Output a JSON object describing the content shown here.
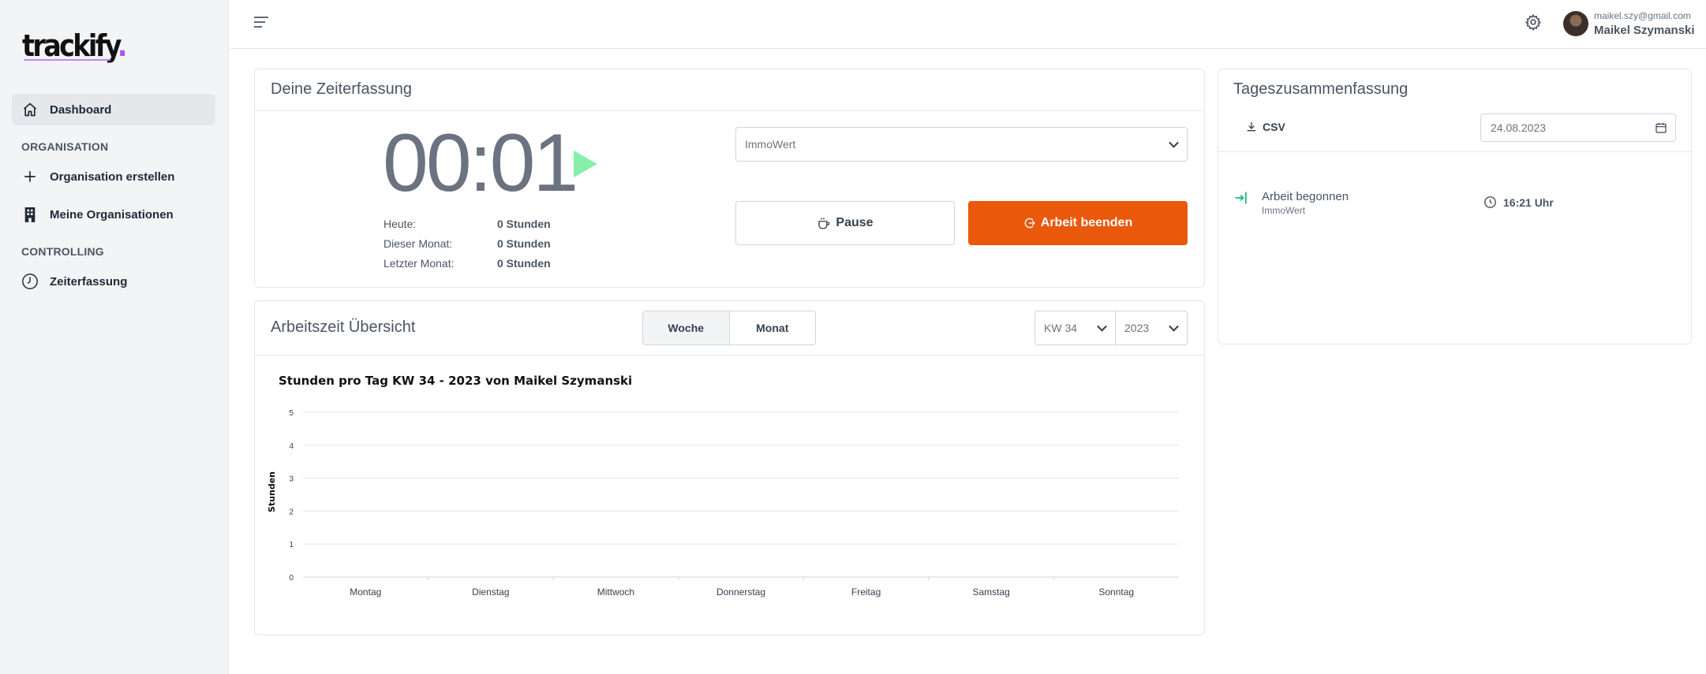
{
  "app": {
    "logo": "trackify",
    "logo_dot": "."
  },
  "sidebar": {
    "dashboard": "Dashboard",
    "section_org": "ORGANISATION",
    "org_create": "Organisation erstellen",
    "my_orgs": "Meine Organisationen",
    "section_ctrl": "CONTROLLING",
    "time_tracking": "Zeiterfassung"
  },
  "user": {
    "email": "maikel.szy@gmail.com",
    "name": "Maikel Szymanski"
  },
  "timer_card": {
    "title": "Deine Zeiterfassung",
    "time": "00:01",
    "stats": [
      {
        "label": "Heute:",
        "value": "0 Stunden"
      },
      {
        "label": "Dieser Monat:",
        "value": "0 Stunden"
      },
      {
        "label": "Letzter Monat:",
        "value": "0 Stunden"
      }
    ],
    "project_select": "ImmoWert",
    "pause_label": "Pause",
    "stop_label": "Arbeit beenden"
  },
  "overview": {
    "title": "Arbeitszeit Übersicht",
    "tab_week": "Woche",
    "tab_month": "Monat",
    "week_select": "KW 34",
    "year_select": "2023"
  },
  "chart_data": {
    "type": "bar",
    "title": "Stunden pro Tag KW 34 - 2023 von Maikel Szymanski",
    "xlabel": "",
    "ylabel": "Stunden",
    "categories": [
      "Montag",
      "Dienstag",
      "Mittwoch",
      "Donnerstag",
      "Freitag",
      "Samstag",
      "Sonntag"
    ],
    "values": [
      0,
      0,
      0,
      0,
      0,
      0,
      0
    ],
    "ylim": [
      0,
      5
    ],
    "yticks": [
      0,
      1,
      2,
      3,
      4,
      5
    ],
    "grid": true
  },
  "summary": {
    "title": "Tageszusammenfassung",
    "csv_label": "CSV",
    "date": "24.08.2023",
    "entry_label": "Arbeit begonnen",
    "entry_project": "ImmoWert",
    "entry_time": "16:21 Uhr",
    "colors": {
      "entry_icon": "#10b981"
    }
  },
  "colors": {
    "stop_button": "#ea580c",
    "play_icon": "#86efac",
    "logo_accent": "#a855f7"
  }
}
